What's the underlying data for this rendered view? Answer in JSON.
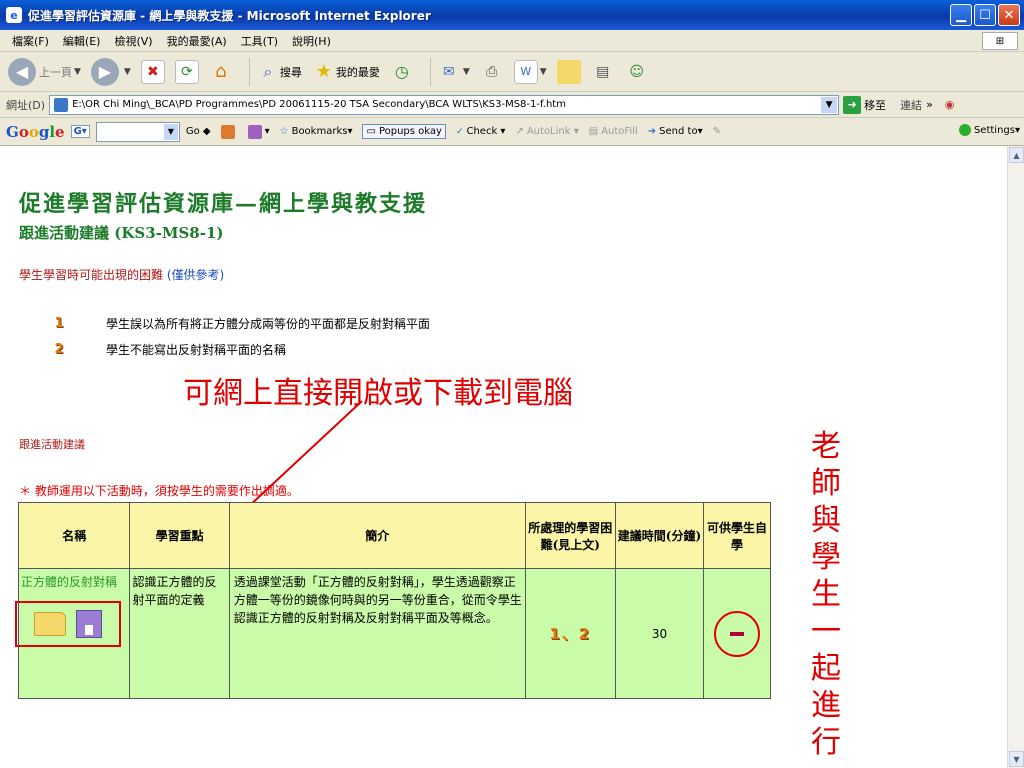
{
  "window": {
    "title": "促進學習評估資源庫 - 網上學與教支援 - Microsoft Internet Explorer"
  },
  "menu": [
    "檔案(F)",
    "編輯(E)",
    "檢視(V)",
    "我的最愛(A)",
    "工具(T)",
    "說明(H)"
  ],
  "toolbar": {
    "back": "上一頁",
    "search": "搜尋",
    "favorites": "我的最愛"
  },
  "address": {
    "label": "網址(D)",
    "url": "E:\\OR Chi Ming\\_BCA\\PD Programmes\\PD 20061115-20 TSA Secondary\\BCA WLTS\\KS3-MS8-1-f.htm",
    "go": "移至",
    "links": "連結"
  },
  "google": {
    "go": "Go",
    "bookmarks": "Bookmarks",
    "popups": "Popups okay",
    "check": "Check",
    "autolink": "AutoLink",
    "autofill": "AutoFill",
    "sendto": "Send to",
    "settings": "Settings"
  },
  "page": {
    "title": "促進學習評估資源庫—網上學與教支援",
    "subtitle": "跟進活動建議 (KS3-MS8-1)",
    "difficulty_heading": "學生學習時可能出現的困難",
    "difficulty_ref": "(僅供參考)",
    "difficulties": [
      {
        "num": "1",
        "text": "學生誤以為所有將正方體分成兩等份的平面都是反射對稱平面"
      },
      {
        "num": "2",
        "text": "學生不能寫出反射對稱平面的名稱"
      }
    ],
    "annotation_online": "可網上直接開啟或下載到電腦",
    "annotation_vertical": "老師與學生一起進行",
    "followup_heading": "跟進活動建議",
    "note": "＊ 教師運用以下活動時，須按學生的需要作出調適。",
    "table": {
      "headers": {
        "name": "名稱",
        "focus": "學習重點",
        "summary": "簡介",
        "difficulty": "所處理的學習困難(見上文)",
        "time": "建議時間(分鐘)",
        "self": "可供學生自學"
      },
      "row": {
        "name": "正方體的反射對稱",
        "focus": "認識正方體的反射平面的定義",
        "summary": "透過課堂活動「正方體的反射對稱」，學生透過觀察正方體一等份的鏡像何時與的另一等份重合，從而令學生認識正方體的反射對稱及反射對稱平面及等概念。",
        "difficulty": "1、2",
        "time": "30"
      }
    }
  },
  "colors": {
    "title_green": "#1d7a2a",
    "annotation_red": "#e00000",
    "header_yellow": "#fbf5a8",
    "row_green": "#c9fba9"
  }
}
